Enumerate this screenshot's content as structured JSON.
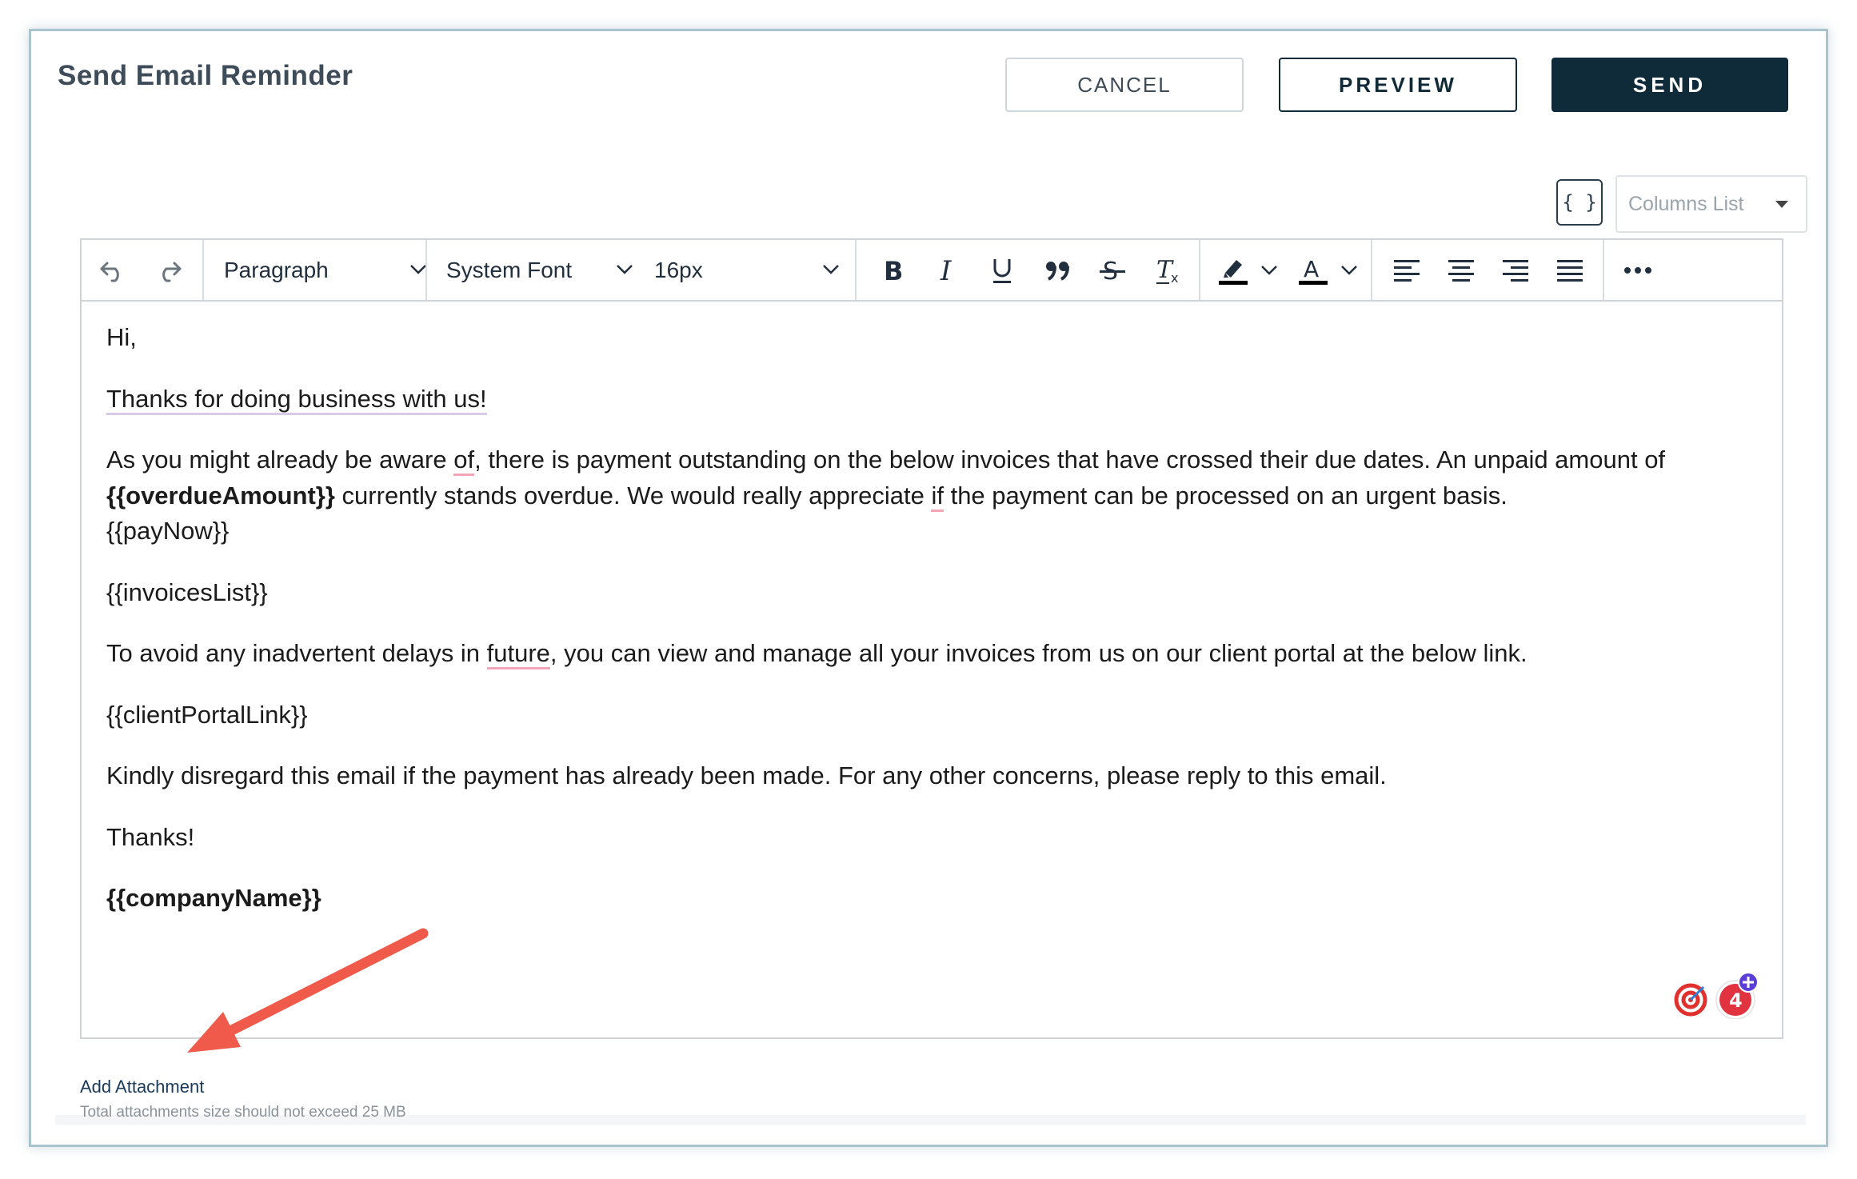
{
  "header": {
    "title": "Send Email Reminder",
    "cancel_label": "CANCEL",
    "preview_label": "PREVIEW",
    "send_label": "SEND"
  },
  "editor_controls": {
    "placeholder_button_label": "{ }",
    "columns_list_placeholder": "Columns List"
  },
  "toolbar": {
    "block_format": "Paragraph",
    "font_family": "System Font",
    "font_size": "16px",
    "icons": [
      "undo-icon",
      "redo-icon",
      "bold-icon",
      "italic-icon",
      "underline-icon",
      "blockquote-icon",
      "strikethrough-icon",
      "clear-format-icon",
      "highlight-color-icon",
      "text-color-icon",
      "align-left-icon",
      "align-center-icon",
      "align-right-icon",
      "justify-icon",
      "more-icon"
    ],
    "highlight_color": "#000000",
    "text_color": "#000000"
  },
  "email_body": {
    "greeting": "Hi,",
    "thanks_line": "Thanks for doing business with us!",
    "para1_a": "As you might already be aware ",
    "para1_of": "of",
    "para1_b": ", there is payment outstanding on the below invoices that have crossed their due dates. An unpaid amount of ",
    "overdue_token": "{{overdueAmount}}",
    "para1_c": " currently stands overdue. We would really appreciate ",
    "para1_if": "if",
    "para1_d": " the payment can be processed on an urgent basis.",
    "pay_now_token": "{{payNow}}",
    "invoices_token": "{{invoicesList}}",
    "para2_a": "To avoid any inadvertent delays in ",
    "para2_future": "future",
    "para2_b": ", you can view and manage all your invoices from us on our client portal at the below link.",
    "portal_token": "{{clientPortalLink}}",
    "para3": "Kindly disregard this email if the payment has already been made. For any other concerns, please reply to this email.",
    "sign_off": "Thanks!",
    "company_token": "{{companyName}}"
  },
  "attachments": {
    "link_label": "Add Attachment",
    "note": "Total attachments size should not exceed 25 MB"
  },
  "extension_badge": {
    "count": "4"
  },
  "colors": {
    "primary_dark": "#0f2a38",
    "annotation_arrow": "#ef5a4a",
    "spellcheck_underline": "#f4a6b7"
  }
}
